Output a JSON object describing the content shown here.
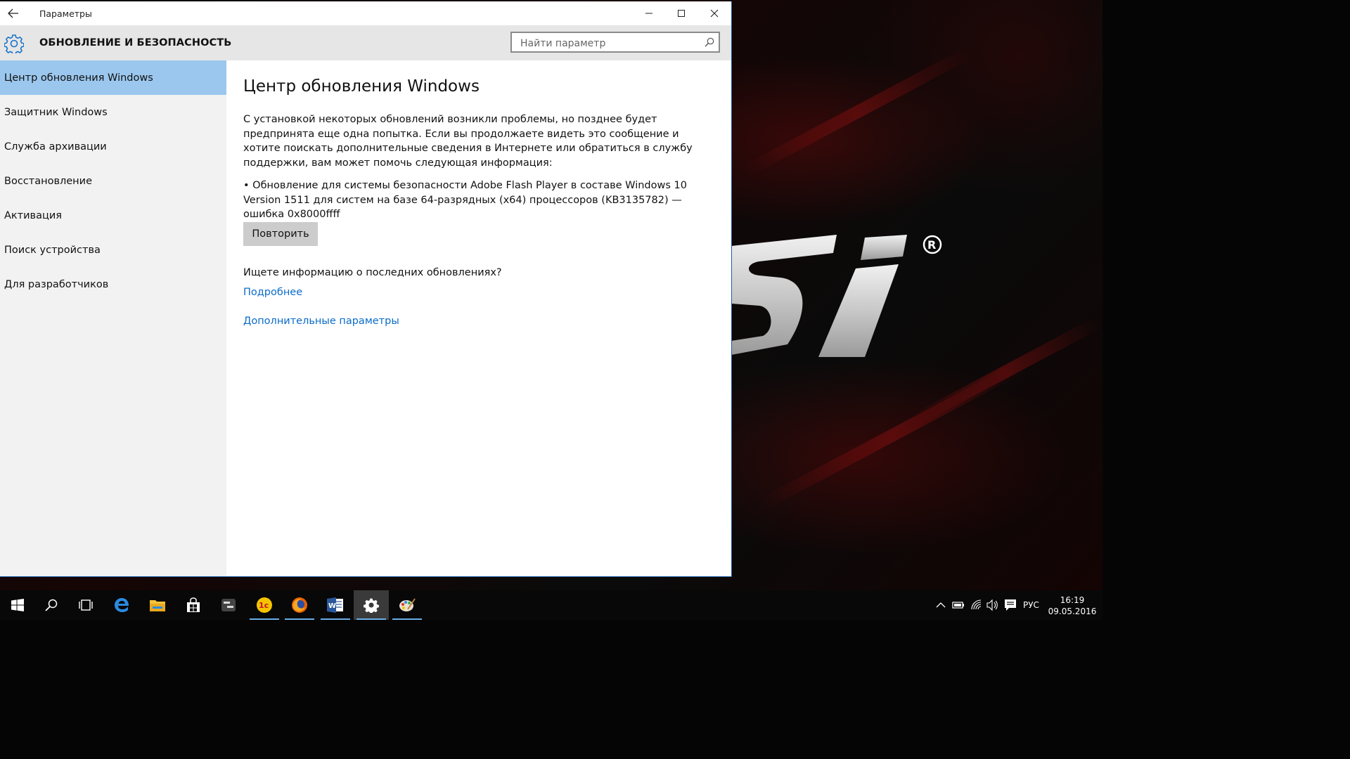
{
  "window": {
    "title": "Параметры",
    "section_title": "ОБНОВЛЕНИЕ И БЕЗОПАСНОСТЬ",
    "search_placeholder": "Найти параметр"
  },
  "sidebar": {
    "items": [
      {
        "label": "Центр обновления Windows",
        "active": true
      },
      {
        "label": "Защитник Windows",
        "active": false
      },
      {
        "label": "Служба архивации",
        "active": false
      },
      {
        "label": "Восстановление",
        "active": false
      },
      {
        "label": "Активация",
        "active": false
      },
      {
        "label": "Поиск устройства",
        "active": false
      },
      {
        "label": "Для разработчиков",
        "active": false
      }
    ]
  },
  "main": {
    "heading": "Центр обновления Windows",
    "message": "С установкой некоторых обновлений возникли проблемы, но позднее будет предпринята еще одна попытка. Если вы продолжаете видеть это сообщение и хотите поискать дополнительные сведения в Интернете или обратиться в службу поддержки, вам может помочь следующая информация:",
    "error_item": "• Обновление для системы безопасности Adobe Flash Player в составе Windows 10 Version 1511 для систем на базе 64-разрядных (x64) процессоров (KB3135782) — ошибка 0x8000ffff",
    "retry_button": "Повторить",
    "question": "Ищете информацию о последних обновлениях?",
    "more_link": "Подробнее",
    "advanced_link": "Дополнительные параметры"
  },
  "taskbar": {
    "apps": [
      "start-icon",
      "search-icon",
      "task-view-icon",
      "edge-icon",
      "file-explorer-icon",
      "store-icon",
      "app-icon",
      "1c-icon",
      "firefox-icon",
      "word-icon",
      "settings-icon",
      "paint-icon"
    ],
    "language": "РУС",
    "time": "16:19",
    "date": "09.05.2016"
  },
  "colors": {
    "accent": "#0a6cc9",
    "selection": "#9bc7ee",
    "sidebar_bg": "#f2f2f2",
    "header_bg": "#e6e6e6"
  }
}
